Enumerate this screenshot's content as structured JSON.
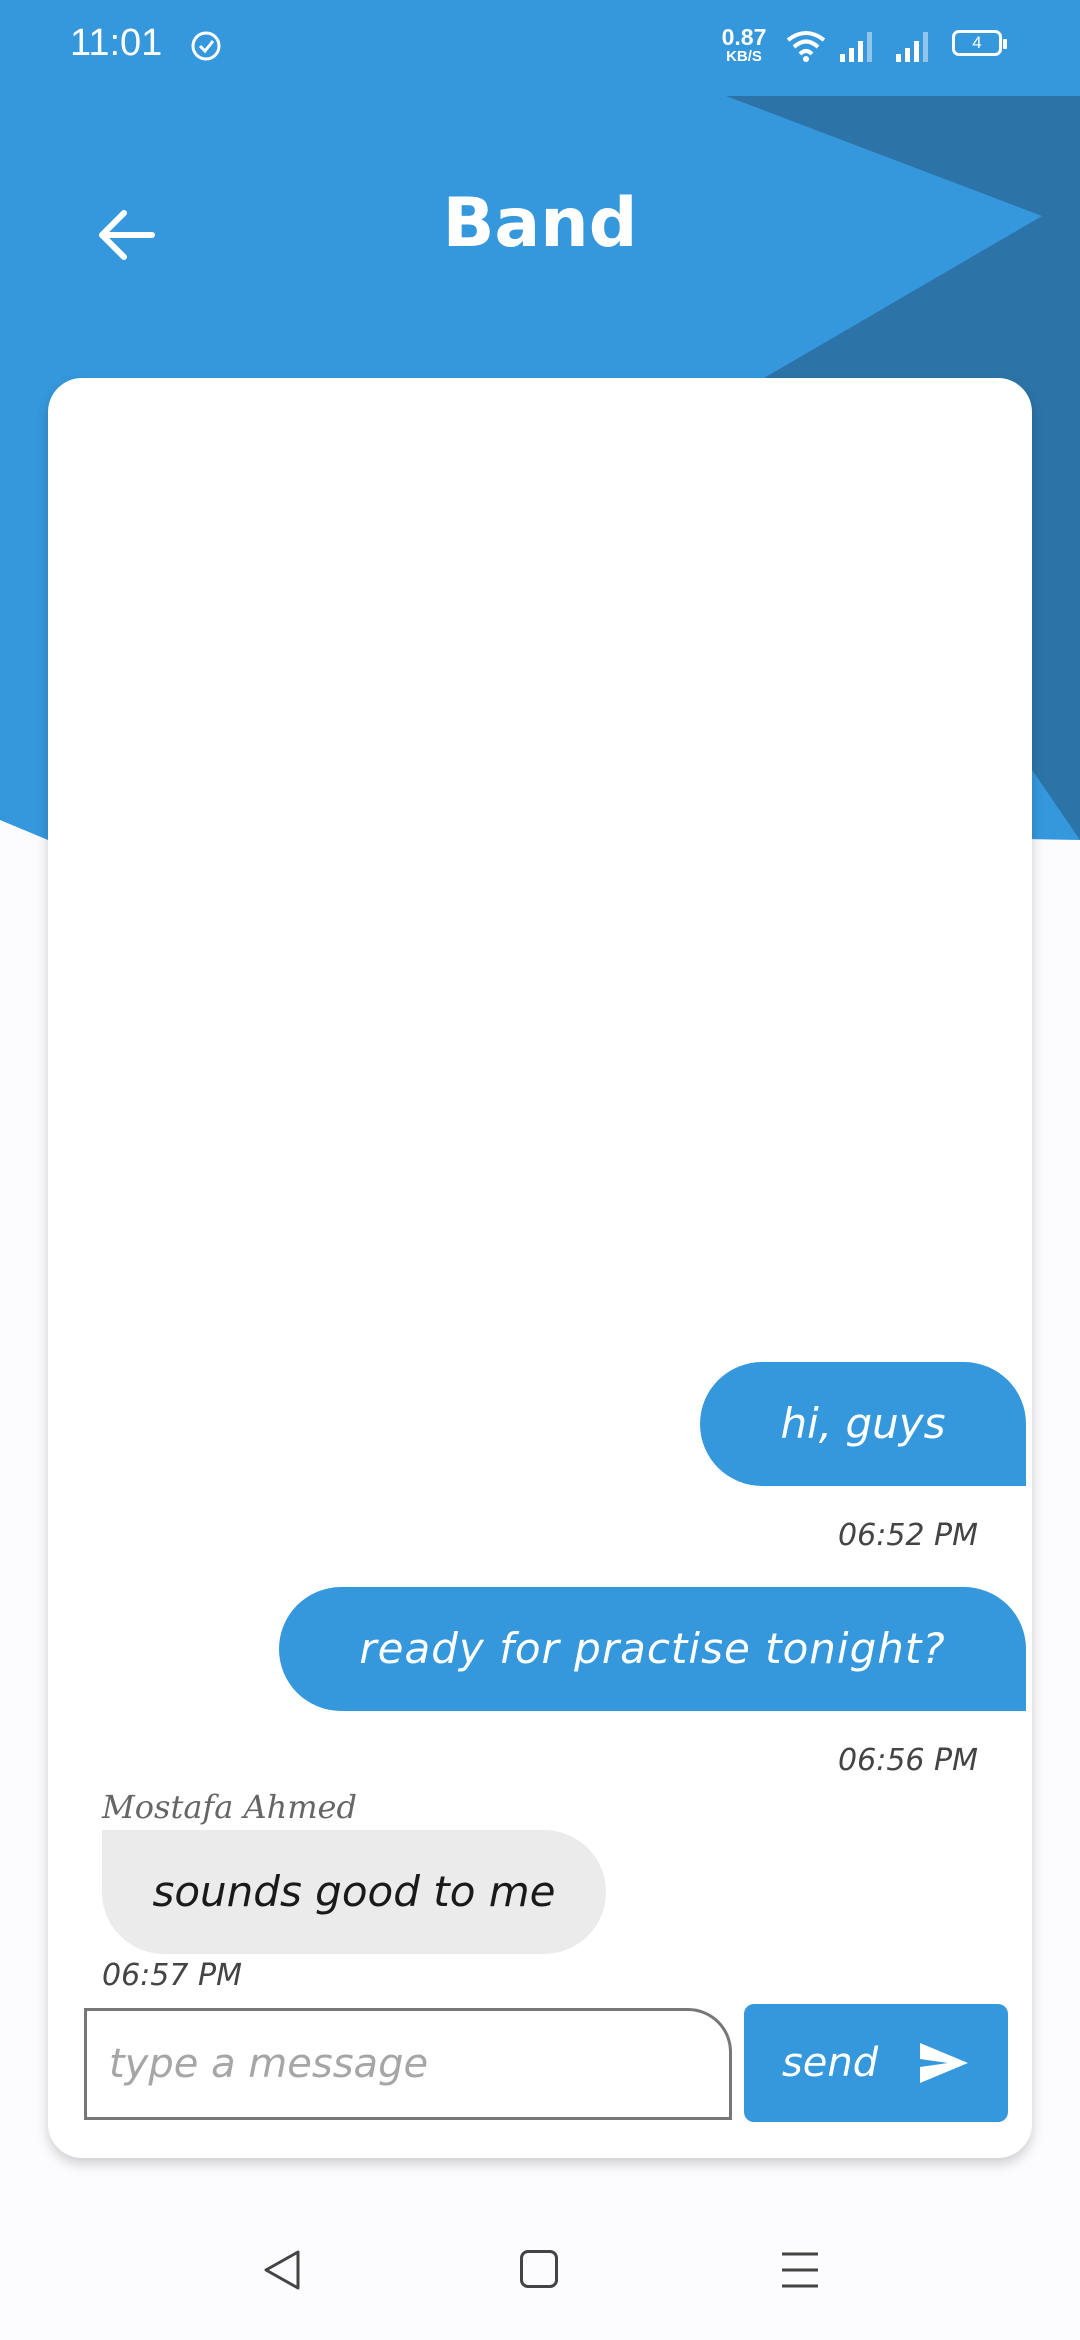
{
  "status_bar": {
    "time": "11:01",
    "net_speed_value": "0.87",
    "net_speed_unit": "KB/S",
    "battery_level": "4"
  },
  "header": {
    "title": "Band"
  },
  "messages": [
    {
      "direction": "outgoing",
      "text": "hi, guys",
      "time": "06:52 PM"
    },
    {
      "direction": "outgoing",
      "text": "ready for practise tonight?",
      "time": "06:56 PM"
    },
    {
      "direction": "incoming",
      "sender": "Mostafa Ahmed",
      "text": "sounds good to me",
      "time": "06:57 PM"
    }
  ],
  "composer": {
    "placeholder": "type a message",
    "value": "",
    "send_label": "send"
  },
  "colors": {
    "primary": "#3598dc",
    "primary_dark": "#2c74a8",
    "incoming_bubble": "#ebebeb",
    "background": "#fcfbfe"
  },
  "icons": {
    "back": "arrow-left-icon",
    "send": "paper-plane-icon",
    "nav": [
      "triangle-back-icon",
      "square-home-icon",
      "menu-lines-icon"
    ]
  }
}
